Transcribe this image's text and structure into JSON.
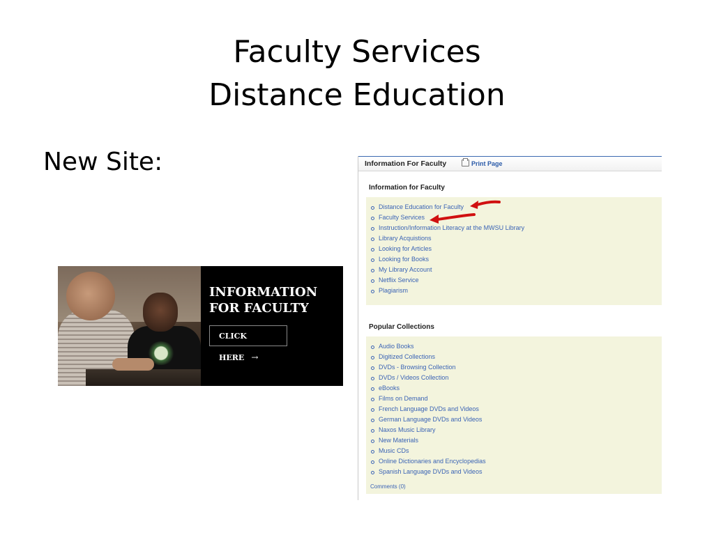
{
  "slide": {
    "title_line1": "Faculty Services",
    "title_line2": "Distance Education",
    "subtitle": "New Site:"
  },
  "banner": {
    "heading_line1": "INFORMATION",
    "heading_line2": "FOR FACULTY",
    "button_label": "CLICK HERE",
    "button_arrow": "→"
  },
  "panel": {
    "header_title": "Information For Faculty",
    "print_label": "Print Page",
    "section1_title": "Information for Faculty",
    "section1_items": [
      "Distance Education for Faculty",
      "Faculty Services",
      "Instruction/Information Literacy at the MWSU Library",
      "Library Acquistions",
      "Looking for Articles",
      "Looking for Books",
      "My Library Account",
      "Netflix Service",
      "Plagiarism"
    ],
    "section2_title": "Popular Collections",
    "section2_items": [
      "Audio Books",
      "Digitized Collections",
      "DVDs - Browsing Collection",
      "DVDs / Videos Collection",
      "eBooks",
      "Films on Demand",
      "French Language DVDs and Videos",
      "German Language DVDs and Videos",
      "Naxos Music Library",
      "New Materials",
      "Music CDs",
      "Online Dictionaries and Encyclopedias",
      "Spanish Language DVDs and Videos"
    ],
    "comments_label": "Comments (0)"
  },
  "colors": {
    "link": "#3a63b5",
    "box_background": "#f3f4dd",
    "arrow_red": "#d01010",
    "banner_background": "#000000"
  }
}
